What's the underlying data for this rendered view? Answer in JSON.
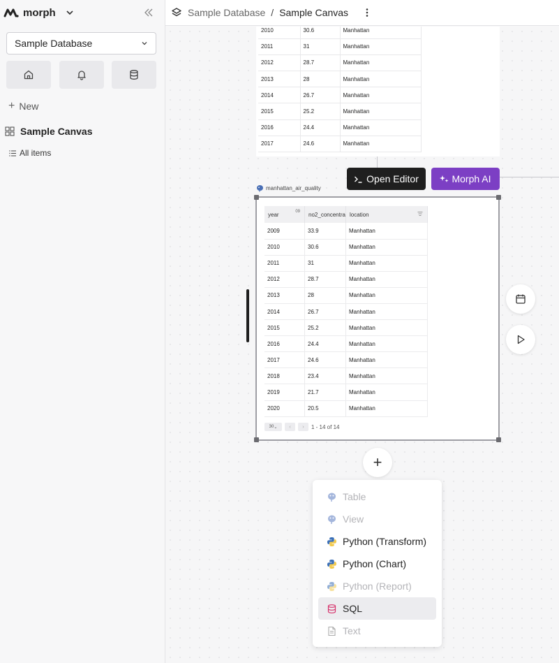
{
  "sidebar": {
    "brand": "morph",
    "database_select": "Sample Database",
    "new_label": "New",
    "canvas_item": "Sample Canvas",
    "all_items": "All items"
  },
  "header": {
    "database": "Sample Database",
    "separator": "/",
    "canvas": "Sample Canvas"
  },
  "toolbar": {
    "open_editor": "Open Editor",
    "morph_ai": "Morph AI"
  },
  "top_card": {
    "rows": [
      [
        "2010",
        "30.6",
        "Manhattan"
      ],
      [
        "2011",
        "31",
        "Manhattan"
      ],
      [
        "2012",
        "28.7",
        "Manhattan"
      ],
      [
        "2013",
        "28",
        "Manhattan"
      ],
      [
        "2014",
        "26.7",
        "Manhattan"
      ],
      [
        "2015",
        "25.2",
        "Manhattan"
      ],
      [
        "2016",
        "24.4",
        "Manhattan"
      ],
      [
        "2017",
        "24.6",
        "Manhattan"
      ]
    ]
  },
  "card": {
    "label": "manhattan_air_quality",
    "columns": [
      "year",
      "no2_concentra",
      "location"
    ],
    "sort_badge": "09",
    "rows": [
      [
        "2009",
        "33.9",
        "Manhattan"
      ],
      [
        "2010",
        "30.6",
        "Manhattan"
      ],
      [
        "2011",
        "31",
        "Manhattan"
      ],
      [
        "2012",
        "28.7",
        "Manhattan"
      ],
      [
        "2013",
        "28",
        "Manhattan"
      ],
      [
        "2014",
        "26.7",
        "Manhattan"
      ],
      [
        "2015",
        "25.2",
        "Manhattan"
      ],
      [
        "2016",
        "24.4",
        "Manhattan"
      ],
      [
        "2017",
        "24.6",
        "Manhattan"
      ],
      [
        "2018",
        "23.4",
        "Manhattan"
      ],
      [
        "2019",
        "21.7",
        "Manhattan"
      ],
      [
        "2020",
        "20.5",
        "Manhattan"
      ]
    ],
    "pager": {
      "page_size": "30",
      "range": "1 - 14 of 14"
    }
  },
  "add_menu": {
    "plus": "+",
    "items": [
      {
        "label": "Table",
        "icon": "postgres-icon",
        "disabled": true
      },
      {
        "label": "View",
        "icon": "postgres-icon",
        "disabled": true
      },
      {
        "label": "Python (Transform)",
        "icon": "python-icon",
        "disabled": false
      },
      {
        "label": "Python (Chart)",
        "icon": "python-icon",
        "disabled": false
      },
      {
        "label": "Python (Report)",
        "icon": "python-icon",
        "disabled": true
      },
      {
        "label": "SQL",
        "icon": "database-icon",
        "disabled": false,
        "active": true
      },
      {
        "label": "Text",
        "icon": "file-text-icon",
        "disabled": true
      }
    ]
  },
  "colors": {
    "morph_ai": "#7c3fc4",
    "open_editor": "#1f1f1f",
    "sql_icon": "#d6336c"
  }
}
